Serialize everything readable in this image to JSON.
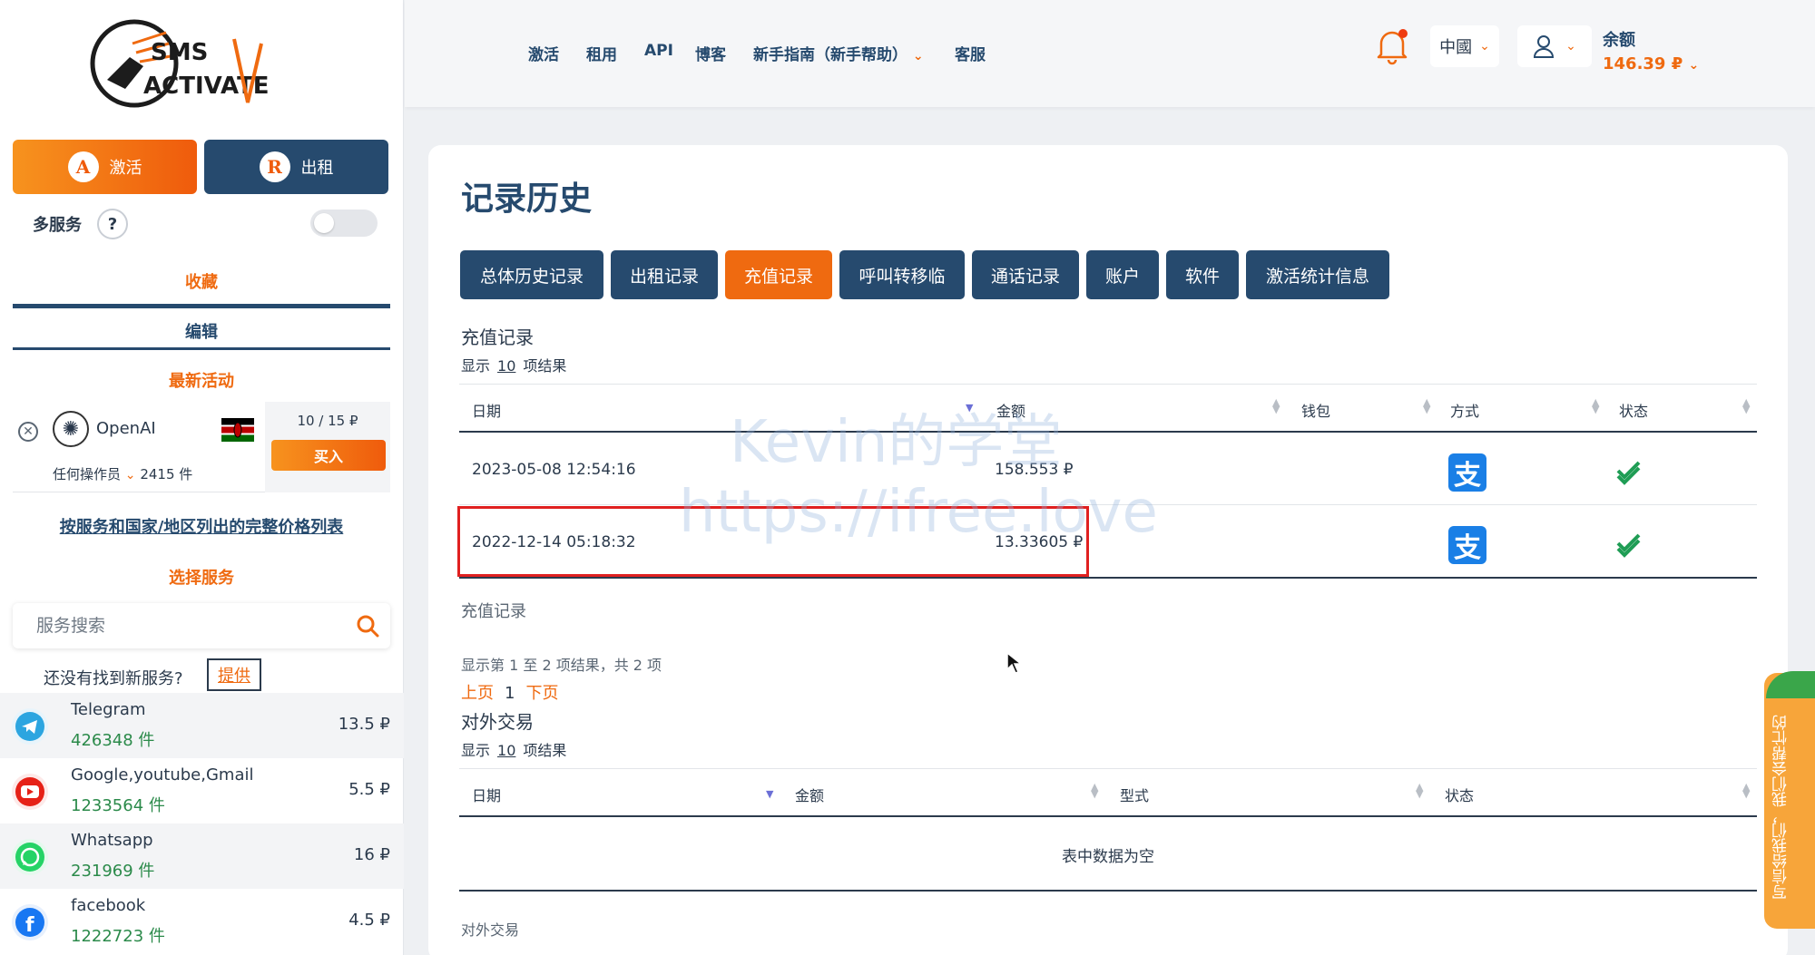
{
  "sidebar": {
    "logo_text_top": "SMS",
    "logo_text_bottom": "ACTIVATE",
    "mode_activate": "激活",
    "mode_rent": "出租",
    "multi_service_label": "多服务",
    "help_glyph": "?",
    "favorites_label": "收藏",
    "edit_label": "编辑",
    "recent_label": "最新活动",
    "recent": {
      "remove_glyph": "✕",
      "service_name": "OpenAI",
      "price": "10 / 15 ₽",
      "buy_label": "买入",
      "operator": "任何操作员",
      "count": "2415 件"
    },
    "price_list_link": "按服务和国家/地区列出的完整价格列表",
    "choose_service_label": "选择服务",
    "search_placeholder": "服务搜索",
    "not_found_text": "还没有找到新服务?",
    "offer_label": "提供",
    "services": [
      {
        "name": "Telegram",
        "count": "426348 件",
        "price": "13.5 ₽",
        "icon": "telegram-icon",
        "color": "#2ca5e0"
      },
      {
        "name": "Google,youtube,Gmail",
        "count": "1233564 件",
        "price": "5.5 ₽",
        "icon": "youtube-icon",
        "color": "#e62117"
      },
      {
        "name": "Whatsapp",
        "count": "231969 件",
        "price": "16 ₽",
        "icon": "whatsapp-icon",
        "color": "#25d366"
      },
      {
        "name": "facebook",
        "count": "1222723 件",
        "price": "4.5 ₽",
        "icon": "facebook-icon",
        "color": "#1877f2"
      }
    ]
  },
  "header": {
    "nav": [
      "激活",
      "租用",
      "API",
      "博客",
      "新手指南（新手帮助）",
      "客服"
    ],
    "language": "中國",
    "balance_label": "余额",
    "balance_value": "146.39 ₽"
  },
  "main": {
    "title": "记录历史",
    "tabs": [
      {
        "label": "总体历史记录",
        "active": false
      },
      {
        "label": "出租记录",
        "active": false
      },
      {
        "label": "充值记录",
        "active": true
      },
      {
        "label": "呼叫转移临",
        "active": false
      },
      {
        "label": "通话记录",
        "active": false
      },
      {
        "label": "账户",
        "active": false
      },
      {
        "label": "软件",
        "active": false
      },
      {
        "label": "激活统计信息",
        "active": false
      }
    ],
    "recharge": {
      "title": "充值记录",
      "show_prefix": "显示",
      "show_count": "10",
      "show_suffix": "项结果",
      "columns": [
        "日期",
        "金额",
        "钱包",
        "方式",
        "状态"
      ],
      "rows": [
        {
          "date": "2023-05-08 12:54:16",
          "amount": "158.553 ₽",
          "wallet": "",
          "method": "alipay",
          "status": "success"
        },
        {
          "date": "2022-12-14 05:18:32",
          "amount": "13.33605 ₽",
          "wallet": "",
          "method": "alipay",
          "status": "success"
        }
      ],
      "caption": "充值记录",
      "info": "显示第 1 至 2 项结果，共 2 项",
      "prev": "上页",
      "page": "1",
      "next": "下页"
    },
    "external": {
      "title": "对外交易",
      "show_prefix": "显示",
      "show_count": "10",
      "show_suffix": "项结果",
      "columns": [
        "日期",
        "金额",
        "型式",
        "状态"
      ],
      "empty": "表中数据为空",
      "caption": "对外交易"
    }
  },
  "watermark": {
    "line1": "Kevin的学堂",
    "line2": "https://ifree.love"
  },
  "feedback_label": "写信给我们，我们会帮忙的",
  "colors": {
    "orange": "#ef6a10",
    "navy": "#264a6e",
    "alipay": "#1a7fe6",
    "success": "#1f9d55"
  }
}
